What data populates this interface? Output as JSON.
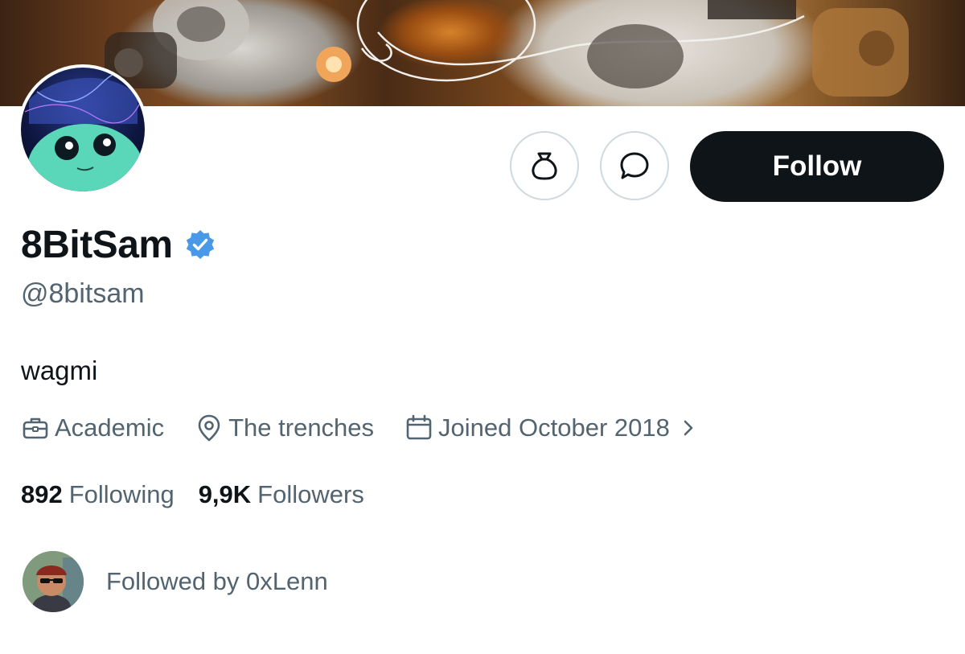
{
  "profile": {
    "display_name": "8BitSam",
    "handle": "@8bitsam",
    "bio": "wagmi",
    "verified": true,
    "verified_color": "#4a99e9"
  },
  "meta": {
    "category": "Academic",
    "location": "The trenches",
    "joined": "Joined October 2018"
  },
  "stats": {
    "following_count": "892",
    "following_label": "Following",
    "followers_count": "9,9K",
    "followers_label": "Followers"
  },
  "followed_by": {
    "text": "Followed by 0xLenn"
  },
  "actions": {
    "follow_label": "Follow",
    "tip_icon": "money-bag-icon",
    "message_icon": "message-bubble-icon"
  },
  "colors": {
    "text_primary": "#0f1419",
    "text_secondary": "#536471",
    "button_dark": "#0f1419",
    "border": "#cfd9de"
  }
}
